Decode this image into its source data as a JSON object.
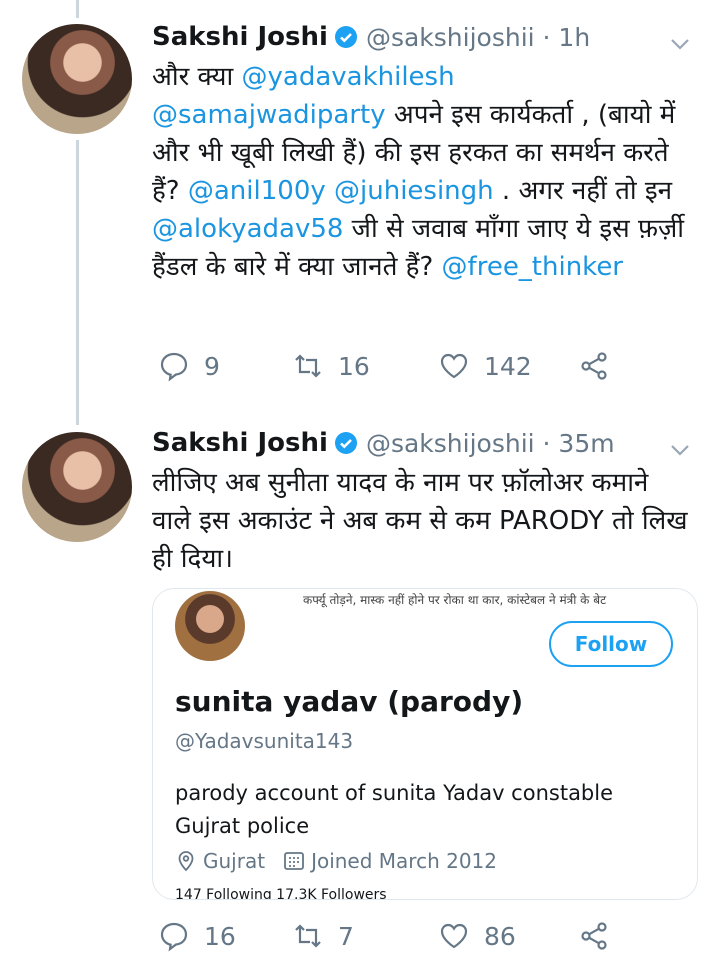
{
  "tweet1": {
    "name": "Sakshi Joshi",
    "handle": "@sakshijoshii · 1h",
    "body": [
      {
        "t": "और क्या ",
        "m": false
      },
      {
        "t": "@yadavakhilesh",
        "m": true
      },
      {
        "t": " ",
        "m": false
      },
      {
        "t": "@samajwadiparty",
        "m": true
      },
      {
        "t": " अपने इस कार्यकर्ता , (बायो में और भी खूबी लिखी हैं) की इस हरकत का समर्थन करते हैं? ",
        "m": false
      },
      {
        "t": "@anil100y",
        "m": true
      },
      {
        "t": " ",
        "m": false
      },
      {
        "t": "@juhiesingh",
        "m": true
      },
      {
        "t": " . अगर नहीं तो इन ",
        "m": false
      },
      {
        "t": "@alokyadav58",
        "m": true
      },
      {
        "t": " जी से जवाब माँगा जाए ये इस फ़र्ज़ी हैंडल के बारे में क्या जानते हैं? ",
        "m": false
      },
      {
        "t": "@free_thinker",
        "m": true
      }
    ],
    "replies": "9",
    "retweets": "16",
    "likes": "142"
  },
  "tweet2": {
    "name": "Sakshi Joshi",
    "handle": "@sakshijoshii · 35m",
    "body": [
      {
        "t": "लीजिए अब सुनीता यादव के नाम पर फ़ॉलोअर कमाने वाले इस अकाउंट ने अब कम से कम PARODY तो लिख ही दिया।",
        "m": false
      }
    ],
    "replies": "16",
    "retweets": "7",
    "likes": "86"
  },
  "card": {
    "banner_text": "कर्फ्यू तोड़ने, मास्क नहीं होने पर रोका था कार, कांस्टेबल ने मंत्री के बेट",
    "follow_label": "Follow",
    "name": "sunita yadav (parody)",
    "handle": "@Yadavsunita143",
    "bio": "parody account of sunita Yadav constable Gujrat police",
    "location": "Gujrat",
    "joined": "Joined March 2012",
    "stats": "147 Following   17.3K Followers"
  },
  "colors": {
    "accent": "#1da1f2",
    "mention": "#1b95e0",
    "muted": "#657786",
    "verified": "#1da1f2"
  },
  "icons": [
    "verified-badge-icon",
    "chevron-down-icon",
    "reply-icon",
    "retweet-icon",
    "like-icon",
    "share-icon",
    "location-icon",
    "calendar-icon"
  ]
}
